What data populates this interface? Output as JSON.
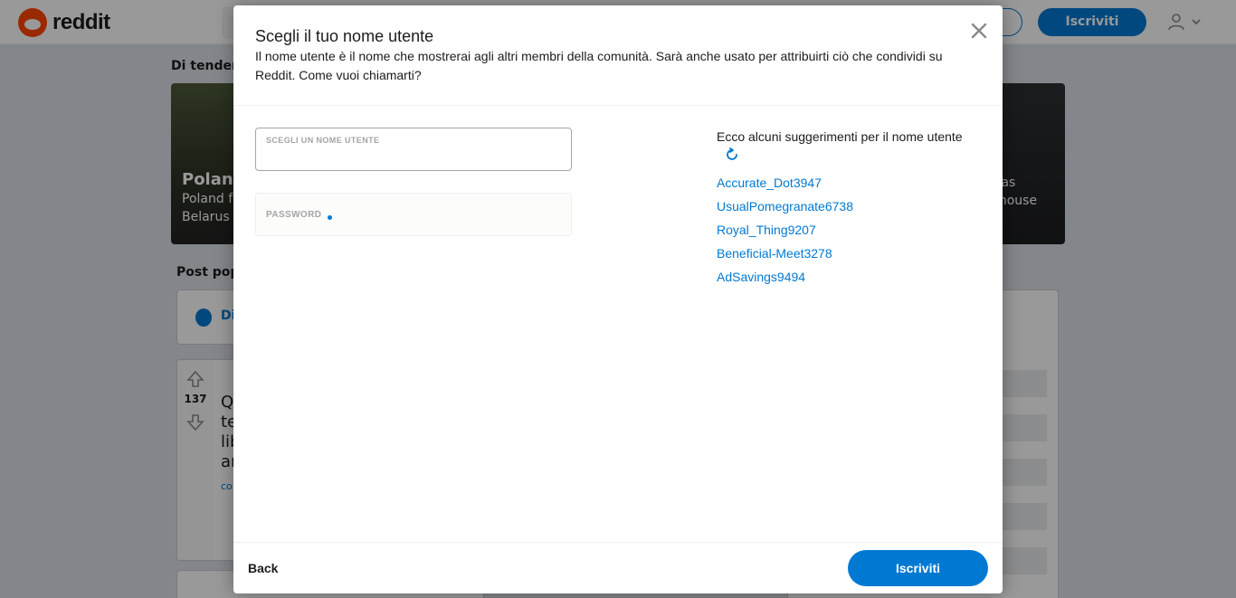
{
  "header": {
    "logo_text": "reddit",
    "signup_label": "Iscriviti"
  },
  "background": {
    "trending_label": "Di tendenz",
    "card1": {
      "title": "Poland",
      "subtitle_line1": "Poland fo",
      "subtitle_line2": "Belarus e"
    },
    "card2": {
      "line1": "was",
      "line2": "nhouse"
    },
    "popular_label": "Post popo",
    "filter_label": "Di",
    "post": {
      "score": "137",
      "title_lines": [
        "Q",
        "te",
        "lib",
        "ar"
      ],
      "meta": "co"
    }
  },
  "modal": {
    "title": "Scegli il tuo nome utente",
    "description": "Il nome utente è il nome che mostrerai agli altri membri della comunità. Sarà anche usato per attribuirti ciò che condividi su Reddit. Come vuoi chiamarti?",
    "username_field": {
      "label": "SCEGLI UN NOME UTENTE",
      "value": ""
    },
    "password_field": {
      "label": "PASSWORD",
      "value": ""
    },
    "suggestions_title": "Ecco alcuni suggerimenti per il nome utente",
    "suggestions": [
      "Accurate_Dot3947",
      "UsualPomegranate6738",
      "Royal_Thing9207",
      "Beneficial-Meet3278",
      "AdSavings9494"
    ],
    "back_label": "Back",
    "submit_label": "Iscriviti"
  },
  "colors": {
    "accent": "#0079d3",
    "brand": "#ff4500"
  },
  "icons": {
    "close": "close-icon",
    "refresh": "refresh-icon",
    "user": "user-icon",
    "chevron": "chevron-down-icon"
  }
}
